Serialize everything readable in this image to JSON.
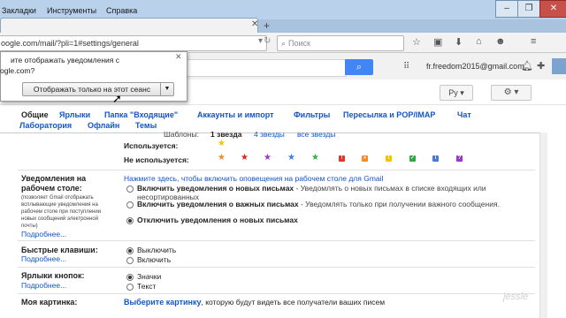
{
  "browser": {
    "menu": [
      {
        "label": "Закладки"
      },
      {
        "label": "Инструменты"
      },
      {
        "label": "Справка"
      }
    ],
    "tab_new": "+",
    "tab_close": "✕",
    "url": "oogle.com/mail/?pli=1#settings/general",
    "search_placeholder": "Поиск"
  },
  "gmail": {
    "account_email": "fr.freedom2015@gmail.com",
    "lang_button": "Ру",
    "gear_button": "⚙ ▾"
  },
  "settings_tabs": [
    "Общие",
    "Ярлыки",
    "Папка \"Входящие\"",
    "Аккаунты и импорт",
    "Фильтры",
    "Пересылка и POP/IMAP",
    "Чат",
    "Лаборатория",
    "Офлайн",
    "Темы"
  ],
  "stars": {
    "templates_label": "Шаблоны:",
    "template_1": "1 звезда",
    "template_4": "4 звезды",
    "template_all": "все звезды",
    "used_label": "Используется:",
    "unused_label": "Не используется:"
  },
  "notifications": {
    "title": "Уведомления на рабочем столе:",
    "hint": "(позволяет Gmail отображать всплывающие уведомления на рабочем столе при поступлении новых сообщений электронной почты)",
    "more": "Подробнее...",
    "enable_link": "Нажмите здесь, чтобы включить оповещения на рабочем столе для Gmail",
    "options": [
      {
        "title": "Включить уведомления о новых письмах",
        "desc": " - Уведомлять о новых письмах в списке входящих или несортированных"
      },
      {
        "title": "Включить уведомления о важных письмах",
        "desc": " - Уведомлять только при получении важного сообщения."
      },
      {
        "title": "Отключить уведомления о новых письмах",
        "desc": ""
      }
    ]
  },
  "hotkeys": {
    "title": "Быстрые клавиши:",
    "more": "Подробнее...",
    "options": [
      "Выключить",
      "Включить"
    ]
  },
  "button_labels": {
    "title": "Ярлыки кнопок:",
    "more": "Подробнее...",
    "options": [
      "Значки",
      "Текст"
    ]
  },
  "my_picture": {
    "title": "Моя картинка:",
    "link": "Выберите картинку",
    "text": ", которую будут видеть все получатели ваших писем"
  },
  "popup": {
    "line1": "ите отображать уведомления с",
    "line2": "ogle.com?",
    "button": "Отображать только на этот сеанс",
    "dropdown": "▼",
    "close": "✕"
  },
  "watermark": "jessle"
}
